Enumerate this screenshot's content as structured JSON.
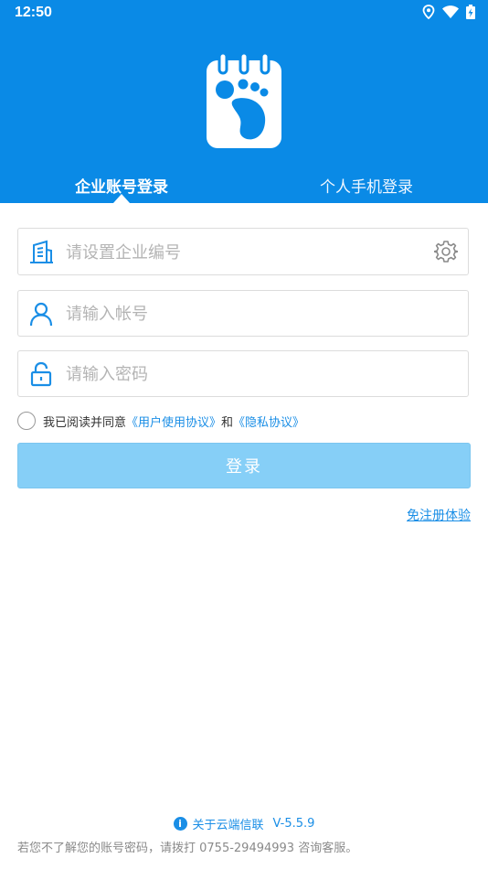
{
  "status_bar": {
    "time": "12:50"
  },
  "tabs": [
    {
      "label": "企业账号登录",
      "active": true
    },
    {
      "label": "个人手机登录",
      "active": false
    }
  ],
  "form": {
    "company_placeholder": "请设置企业编号",
    "account_placeholder": "请输入帐号",
    "password_placeholder": "请输入密码"
  },
  "agreement": {
    "prefix": "我已阅读并同意",
    "user_agreement": "《用户使用协议》",
    "and": "和",
    "privacy": "《隐私协议》",
    "checked": false
  },
  "login_label": "登录",
  "trial_link": "免注册体验",
  "footer": {
    "about": "关于云端信联",
    "version": "V-5.5.9",
    "help": "若您不了解您的账号密码，请拨打 0755-29494993 咨询客服。"
  },
  "colors": {
    "brand": "#0a8ae6",
    "button": "#86cff7",
    "link": "#1a8ee6"
  },
  "icons": [
    "location-icon",
    "wifi-icon",
    "battery-icon",
    "footprint-calendar-logo",
    "building-icon",
    "gear-icon",
    "user-icon",
    "lock-icon",
    "info-icon"
  ]
}
